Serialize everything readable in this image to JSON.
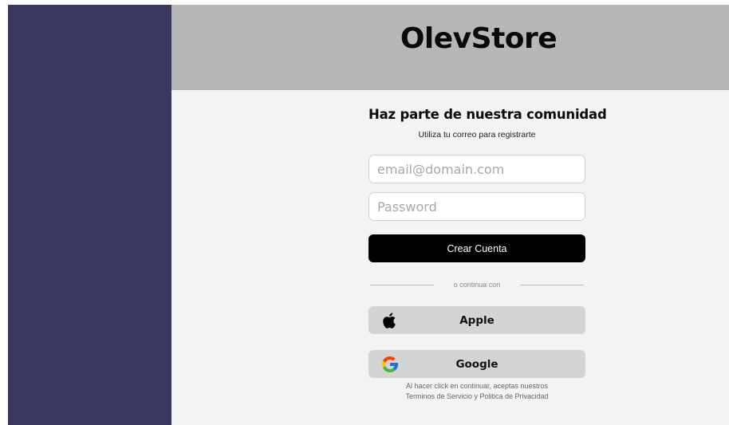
{
  "header": {
    "brand": "OlevStore"
  },
  "form": {
    "title": "Haz parte de nuestra comunidad",
    "subtitle": "Utiliza tu correo para registrarte",
    "email_placeholder": "email@domain.com",
    "password_placeholder": "Password",
    "submit_label": "Crear Cuenta",
    "divider_text": "o continua con"
  },
  "social": [
    {
      "label": "Apple",
      "icon": "apple-icon"
    },
    {
      "label": "Google",
      "icon": "google-icon"
    }
  ],
  "legal": {
    "line1": "Al hacer click en continuar, aceptas nuestros",
    "line2": "Terminos de Servicio y Politica de Privacidad"
  },
  "colors": {
    "sidebar": "#383863",
    "header": "#b7b7b7",
    "background": "#f3f3f3",
    "primary_button": "#000000",
    "social_button": "#d4d4d4"
  }
}
